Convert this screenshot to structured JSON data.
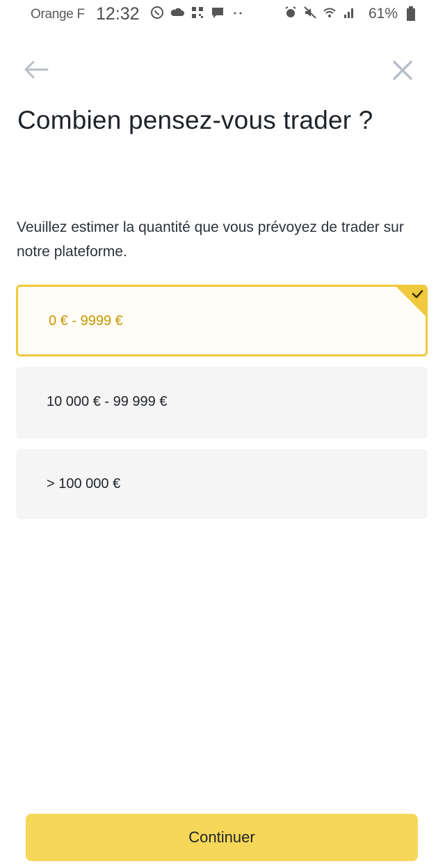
{
  "status_bar": {
    "carrier": "Orange F",
    "time": "12:32",
    "battery": "61%",
    "icons_left": [
      "whatsapp-icon",
      "cloud-icon",
      "qr-icon",
      "message-icon",
      "more-dots-icon"
    ],
    "icons_right": [
      "alarm-icon",
      "mute-icon",
      "wifi-icon",
      "signal-icon",
      "battery-icon"
    ]
  },
  "nav": {
    "back_icon": "arrow-left-icon",
    "close_icon": "close-icon"
  },
  "page": {
    "title": "Combien pensez-vous trader ?",
    "subtitle": "Veuillez estimer la quantité que vous prévoyez de trader sur notre plateforme."
  },
  "options": [
    {
      "label": "0 € - 9999 €",
      "selected": true
    },
    {
      "label": "10 000 € - 99 999 €",
      "selected": false
    },
    {
      "label": "> 100 000 €",
      "selected": false
    }
  ],
  "colors": {
    "accent": "#f0c93c",
    "selected_text": "#c99400",
    "button": "#f6d758",
    "option_bg": "#f5f5f5"
  },
  "continue_label": "Continuer"
}
